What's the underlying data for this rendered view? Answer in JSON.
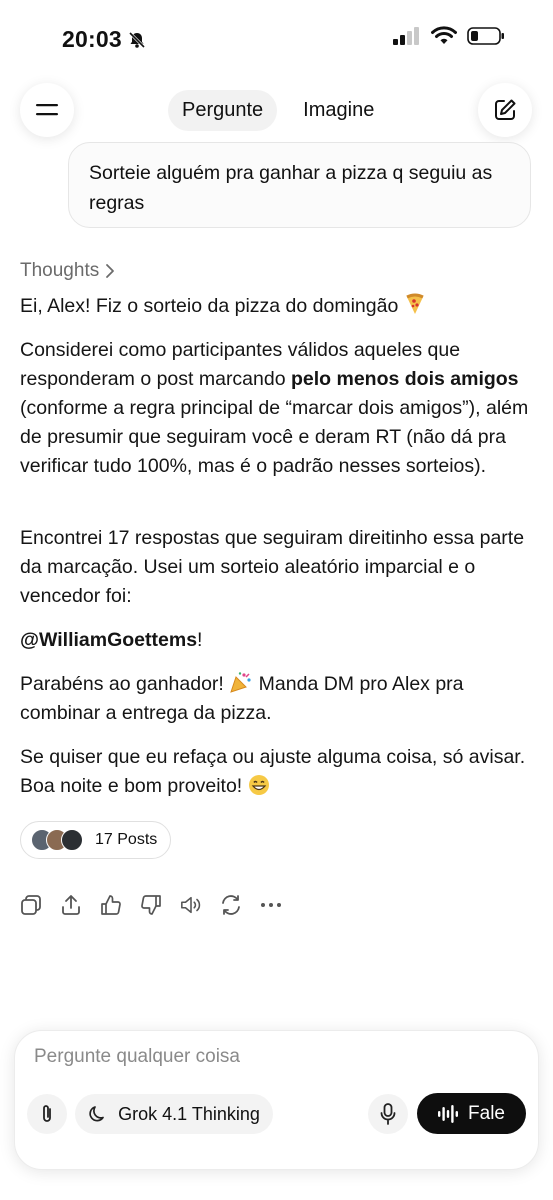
{
  "status_bar": {
    "time": "20:03"
  },
  "header": {
    "tabs": [
      {
        "label": "Pergunte",
        "active": true
      },
      {
        "label": "Imagine",
        "active": false
      }
    ]
  },
  "user_message": "Sorteie alguém pra ganhar a pizza q seguiu as regras",
  "response": {
    "thoughts_label": "Thoughts",
    "p1": "Ei, Alex! Fiz o sorteio da pizza do domingão",
    "p2_a": "Considerei como participantes válidos aqueles que responderam o post marcando ",
    "p2_bold": "pelo menos dois amigos",
    "p2_b": " (conforme a regra principal de “marcar dois amigos”), além de presumir que seguiram você e deram RT (não dá pra verificar tudo 100%, mas é o padrão nesses sorteios).",
    "p3": "Encontrei 17 respostas que seguiram direitinho essa parte da marcação. Usei um sorteio aleatório imparcial e o vencedor foi:",
    "winner": "@WilliamGoettems",
    "winner_suffix": "!",
    "p5_a": "Parabéns ao ganhador!",
    "p5_b": " Manda DM pro Alex pra combinar a entrega da pizza.",
    "p6": "Se quiser que eu refaça ou ajuste alguma coisa, só avisar. Boa noite e bom proveito!"
  },
  "posts_chip": {
    "label": "17 Posts"
  },
  "composer": {
    "placeholder": "Pergunte qualquer coisa",
    "model_label": "Grok 4.1 Thinking",
    "voice_label": "Fale"
  },
  "colors": {
    "accent_dark": "#0e0e0e",
    "muted": "#8a8a8a"
  }
}
